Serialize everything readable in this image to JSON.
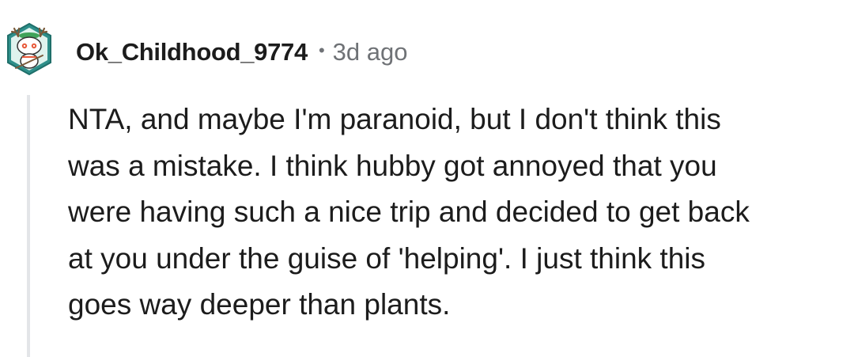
{
  "comment": {
    "author": "Ok_Childhood_9774",
    "separator": "•",
    "timestamp": "3d ago",
    "avatar_icon": "snoo-avatar-icon",
    "body": "NTA, and maybe I'm paranoid, but I don't think this\nwas a mistake. I think hubby got annoyed that you\nwere having such a nice trip and decided to get back\nat you under the guise of 'helping'. I just think this\ngoes way deeper than plants."
  },
  "colors": {
    "text": "#1c1c1c",
    "meta": "#6f7276",
    "thread_line": "#e3e5e8",
    "avatar_bg": "#2e8f8a"
  }
}
